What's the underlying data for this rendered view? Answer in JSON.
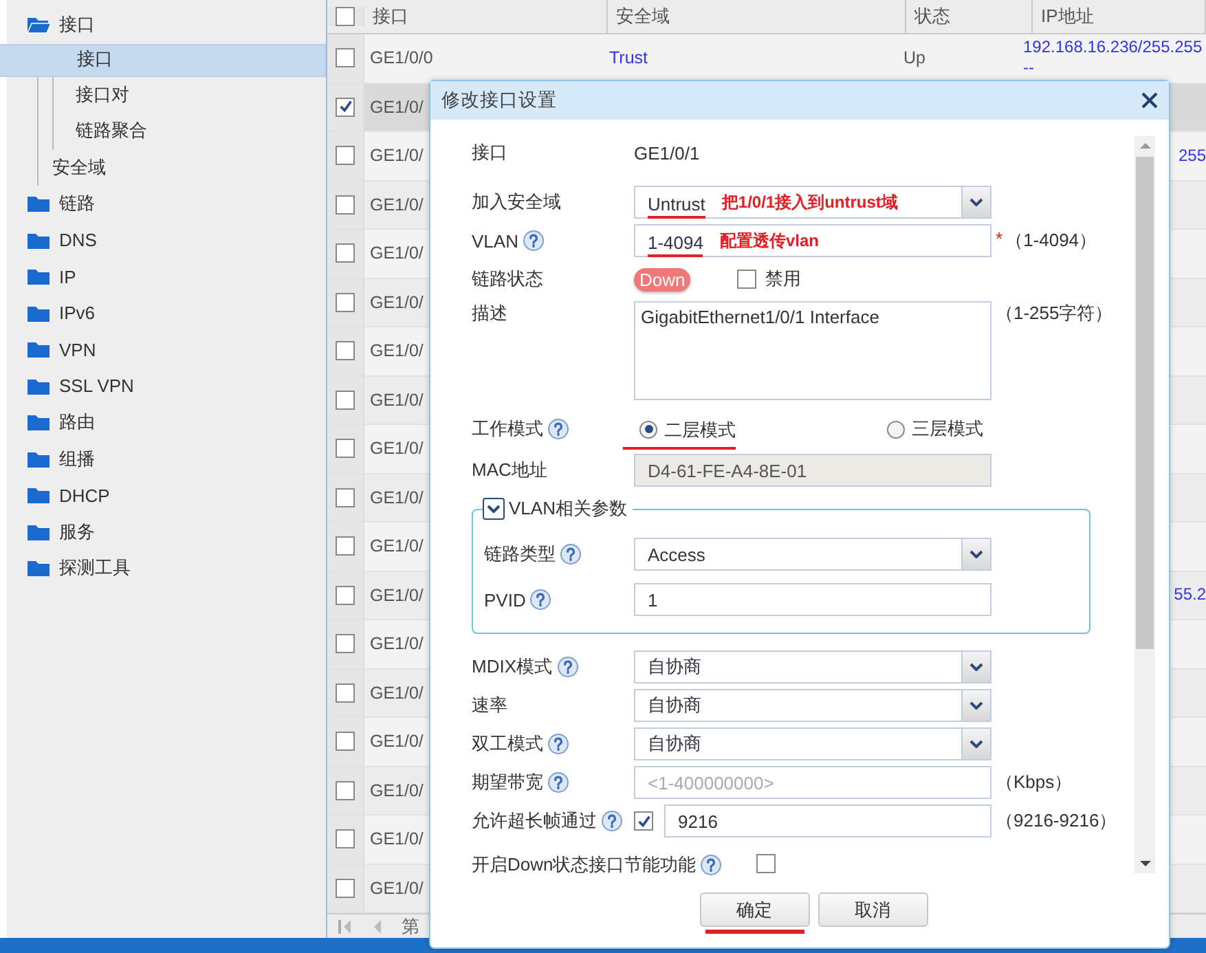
{
  "sidebar": {
    "items": [
      {
        "label": "接口",
        "expanded": true,
        "children": [
          {
            "children": [
              {
                "label": "接口",
                "selected": true
              },
              {
                "label": "接口对",
                "selected": false
              },
              {
                "label": "链路聚合",
                "selected": false
              }
            ]
          },
          {
            "label": "安全域",
            "selected": false
          }
        ]
      },
      {
        "label": "链路",
        "expanded": false
      },
      {
        "label": "DNS",
        "expanded": false
      },
      {
        "label": "IP",
        "expanded": false
      },
      {
        "label": "IPv6",
        "expanded": false
      },
      {
        "label": "VPN",
        "expanded": false
      },
      {
        "label": "SSL VPN",
        "expanded": false
      },
      {
        "label": "路由",
        "expanded": false
      },
      {
        "label": "组播",
        "expanded": false
      },
      {
        "label": "DHCP",
        "expanded": false
      },
      {
        "label": "服务",
        "expanded": false
      },
      {
        "label": "探测工具",
        "expanded": false
      }
    ]
  },
  "table": {
    "header_checked": false,
    "columns": [
      "接口",
      "安全域",
      "状态",
      "IP地址"
    ],
    "rows": [
      {
        "checked": false,
        "interface": "GE1/0/0",
        "zone": "Trust",
        "status": "Up",
        "ip": "192.168.16.236/255.255",
        "ip_line_2": "--"
      },
      {
        "checked": true,
        "interface": "GE1/0/"
      },
      {
        "checked": false,
        "interface": "GE1/0/",
        "ip": "255"
      },
      {
        "checked": false,
        "interface": "GE1/0/"
      },
      {
        "checked": false,
        "interface": "GE1/0/"
      },
      {
        "checked": false,
        "interface": "GE1/0/"
      },
      {
        "checked": false,
        "interface": "GE1/0/"
      },
      {
        "checked": false,
        "interface": "GE1/0/"
      },
      {
        "checked": false,
        "interface": "GE1/0/"
      },
      {
        "checked": false,
        "interface": "GE1/0/"
      },
      {
        "checked": false,
        "interface": "GE1/0/"
      },
      {
        "checked": false,
        "interface": "GE1/0/",
        "ip": "55.2"
      },
      {
        "checked": false,
        "interface": "GE1/0/"
      },
      {
        "checked": false,
        "interface": "GE1/0/"
      },
      {
        "checked": false,
        "interface": "GE1/0/"
      },
      {
        "checked": false,
        "interface": "GE1/0/"
      },
      {
        "checked": false,
        "interface": "GE1/0/"
      },
      {
        "checked": false,
        "interface": "GE1/0/"
      }
    ],
    "pager": {
      "label": "第"
    }
  },
  "dialog": {
    "title": "修改接口设置",
    "fields": [
      {
        "kind": "text",
        "label": "接口",
        "help": false,
        "value": "GE1/0/1"
      },
      {
        "kind": "select",
        "label": "加入安全域",
        "help": false,
        "value": "Untrust",
        "underlined": true,
        "note": "把1/0/1接入到untrust域"
      },
      {
        "kind": "input",
        "label": "VLAN",
        "help": true,
        "value": "1-4094",
        "underlined": true,
        "note": "配置透传vlan",
        "required": "*",
        "suffix": "（1-4094）"
      },
      {
        "kind": "status",
        "label": "链路状态",
        "help": false,
        "status": "Down",
        "checkbox_label": "禁用",
        "checked": false
      },
      {
        "kind": "textarea",
        "label": "描述",
        "help": false,
        "value": "GigabitEthernet1/0/1 Interface",
        "suffix": "（1-255字符）"
      },
      {
        "kind": "radio",
        "label": "工作模式",
        "help": true,
        "underlined": true,
        "options": [
          {
            "label": "二层模式",
            "selected": true
          },
          {
            "label": "三层模式",
            "selected": false
          }
        ]
      },
      {
        "kind": "readonly",
        "label": "MAC地址",
        "help": false,
        "value": "D4-61-FE-A4-8E-01"
      },
      {
        "kind": "group",
        "label": "VLAN相关参数",
        "expanded": true,
        "children": [
          {
            "kind": "select",
            "label": "链路类型",
            "help": true,
            "value": "Access"
          },
          {
            "kind": "input",
            "label": "PVID",
            "help": true,
            "value": "1"
          }
        ]
      },
      {
        "kind": "select",
        "label": "MDIX模式",
        "help": true,
        "value": "自协商"
      },
      {
        "kind": "select",
        "label": "速率",
        "help": false,
        "value": "自协商"
      },
      {
        "kind": "select",
        "label": "双工模式",
        "help": true,
        "value": "自协商"
      },
      {
        "kind": "input",
        "label": "期望带宽",
        "help": true,
        "placeholder": "<1-400000000>",
        "suffix": "（Kbps）"
      },
      {
        "kind": "checkbox_input",
        "label": "允许超长帧通过",
        "help": true,
        "checked": true,
        "value": "9216",
        "suffix": "（9216-9216）"
      },
      {
        "kind": "checkbox",
        "label": "开启Down状态接口节能功能",
        "help": true,
        "checked": false
      }
    ],
    "buttons": [
      {
        "label": "确定",
        "underlined": true
      },
      {
        "label": "取消",
        "underlined": false
      }
    ]
  }
}
